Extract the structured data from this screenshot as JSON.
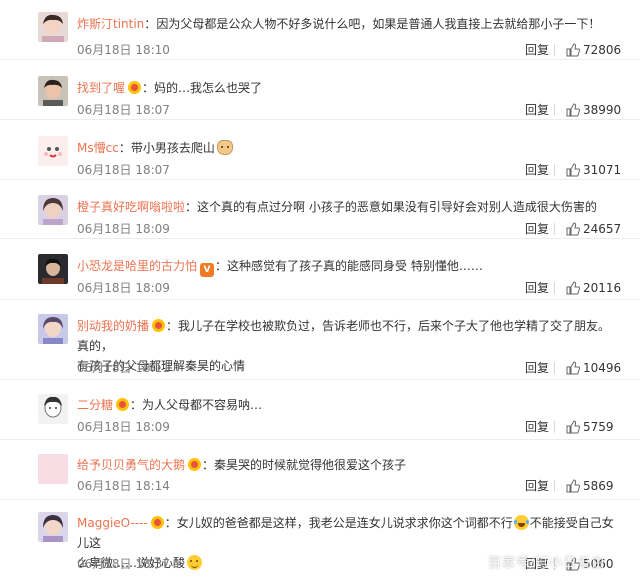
{
  "accent_color": "#eb7350",
  "reply_label": "回复",
  "comments": [
    {
      "username": "炸斯汀tintin",
      "badge": "",
      "text": "因为父母都是公众人物不好多说什么吧，如果是普通人我直接上去就给那小子一下！",
      "text2": "",
      "time": "06月18日 18:10",
      "likes": "72806"
    },
    {
      "username": "找到了喔",
      "badge": "vip",
      "text": "妈的…我怎么也哭了",
      "text2": "",
      "time": "06月18日 18:07",
      "likes": "38990"
    },
    {
      "username": "Ms懵cc",
      "badge": "",
      "text": "带小男孩去爬山",
      "text2": "",
      "emoji": "dog-emoji",
      "time": "06月18日 18:07",
      "likes": "31071"
    },
    {
      "username": "橙子真好吃啊嗡啦啦",
      "badge": "",
      "text": "这个真的有点过分啊 小孩子的恶意如果没有引导好会对别人造成很大伤害的",
      "text2": "",
      "time": "06月18日 18:09",
      "likes": "24657"
    },
    {
      "username": "小恐龙是哈里的古力怕",
      "badge": "v",
      "text": "这种感觉有了孩子真的能感同身受 特别懂他……",
      "text2": "",
      "time": "06月18日 18:09",
      "likes": "20116"
    },
    {
      "username": "别动我的奶播",
      "badge": "vip",
      "text": "我儿子在学校也被欺负过，告诉老师也不行，后来个子大了他也学精了交了朋友。真的，",
      "text2": "有孩子的父母都理解秦昊的心情",
      "time": "06月18日 18:11",
      "likes": "10496"
    },
    {
      "username": "二分糖",
      "badge": "vip",
      "text": "为人父母都不容易呐…",
      "text2": "",
      "time": "06月18日 18:09",
      "likes": "5759"
    },
    {
      "username": "给予贝贝勇气的大鹅",
      "badge": "vip",
      "text": "秦昊哭的时候就觉得他很爱这个孩子",
      "text2": "",
      "time": "06月18日 18:14",
      "likes": "5869"
    },
    {
      "username": "MaggieO----",
      "badge": "vip",
      "text": "女儿奴的爸爸都是这样，我老公是连女儿说求求你这个词都不行",
      "text_after_emoji": "不能接受自己女儿这",
      "text2": "么卑微……说好心酸",
      "time": "06月18日 18:37",
      "likes": "5060"
    }
  ],
  "watermark": "百家号/町小日自由"
}
